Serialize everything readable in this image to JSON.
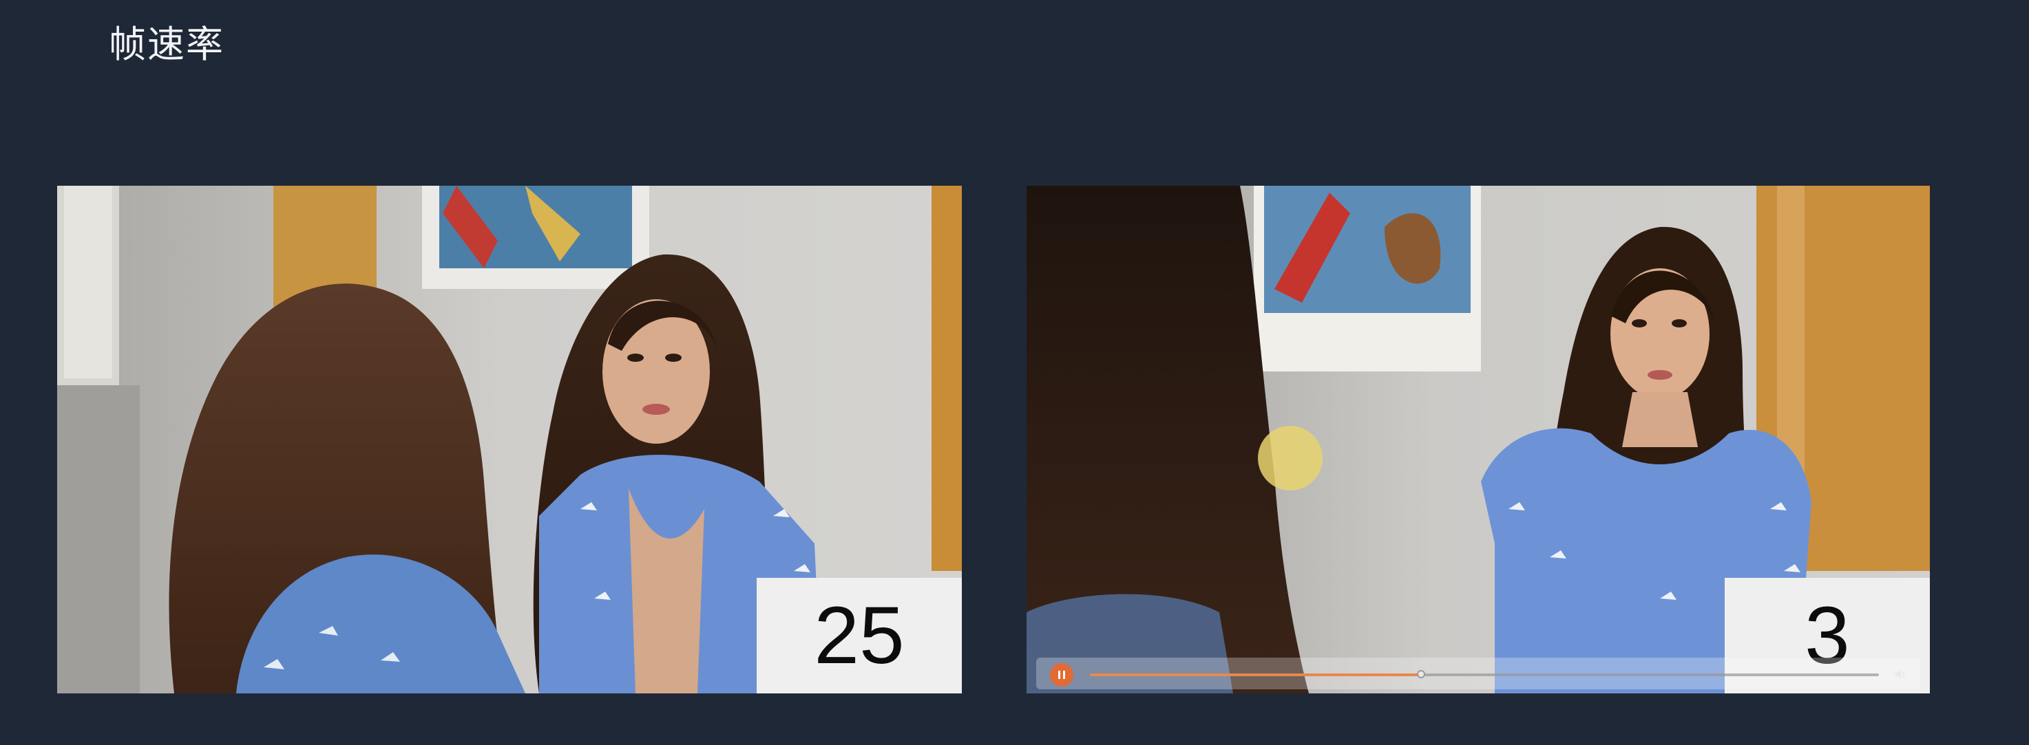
{
  "slide": {
    "title": "帧速率"
  },
  "videos": [
    {
      "id": "left",
      "frame_rate_label": "25"
    },
    {
      "id": "right",
      "frame_rate_label": "3"
    }
  ],
  "player": {
    "state": "playing",
    "progress_fraction": 0.42,
    "accent_color": "#e26a35"
  },
  "colors": {
    "background": "#1f2836",
    "title_text": "#f2f4f7",
    "counter_bg": "#efefef"
  },
  "icons": {
    "pause": "pause-icon",
    "volume": "volume-icon",
    "cursor_highlight": "yellow-circle"
  }
}
